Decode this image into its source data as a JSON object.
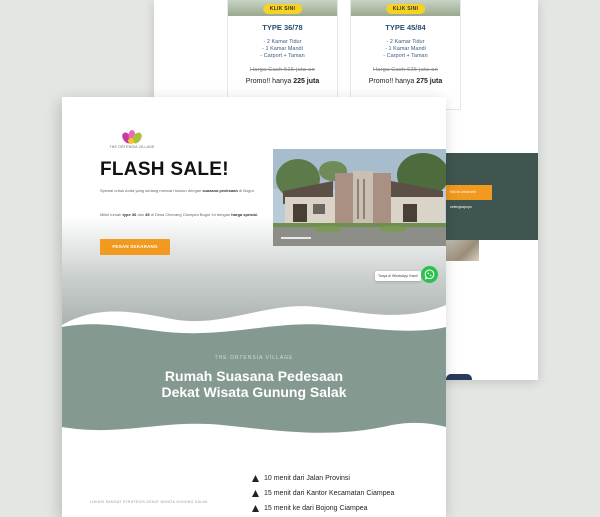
{
  "back_page": {
    "cards": [
      {
        "button": "KLIK SINI",
        "type": "TYPE 36/78",
        "features": [
          "- 2 Kamar Tidur",
          "- 1 Kamar Mandi",
          "- Carport + Taman"
        ],
        "price_old": "Harga Cash 515 juta-an",
        "promo_prefix": "Promo!! hanya ",
        "promo_value": "225 juta"
      },
      {
        "button": "KLIK SINI",
        "type": "TYPE 45/84",
        "features": [
          "- 2 Kamar Tidur",
          "- 1 Kamar Mandi",
          "- Carport + Taman"
        ],
        "price_old": "Harga Cash 625 juta-an",
        "promo_prefix": "Promo!! hanya ",
        "promo_value": "275 juta"
      }
    ],
    "band_button": "Klik ini untuk info selengkapnya"
  },
  "front_page": {
    "logo_text": "THE ORTENSIA VILLAGE",
    "hero": {
      "title": "FLASH SALE!",
      "desc1_prefix": "Spesial untuk Anda yang sedang mencari hunian dengan ",
      "desc1_hl": "suasana pedesaan",
      "desc1_suffix": " di Bogor.",
      "desc2_a": "Miliki rumah ",
      "desc2_b": "type 36",
      "desc2_c": " dan ",
      "desc2_d": "45",
      "desc2_e": " di Desa Ciherang Ciampea Bogor ini dengan ",
      "desc2_f": "harga spesial.",
      "button": "PESAN SEKARANG"
    },
    "whatsapp_tag": "Tanya di WhatsApp Kami!",
    "section": {
      "label": "THE ORTENSIA VILLAGE",
      "title_line1": "Rumah Suasana Pedesaan",
      "title_line2": "Dekat Wisata Gunung Salak"
    },
    "caption": "LOKASI SANGAT STRATEGIS DEKAT WISATA GUNUNG SALAK",
    "info": [
      {
        "icon": "car-icon",
        "text": "10 menit dari Jalan Provinsi"
      },
      {
        "icon": "car-icon",
        "text": "15 menit dari Kantor Kecamatan Ciampea"
      },
      {
        "icon": "car-icon",
        "text": "15 menit ke dari Bojong Ciampea"
      }
    ]
  },
  "colors": {
    "background": "#e3e6e2",
    "accent_orange": "#f29a1f",
    "sage": "#849a91",
    "dark_teal": "#3f5550",
    "whatsapp_green": "#29c24e",
    "price_blue": "#2a4e74",
    "klik_yellow": "#f5d320"
  }
}
